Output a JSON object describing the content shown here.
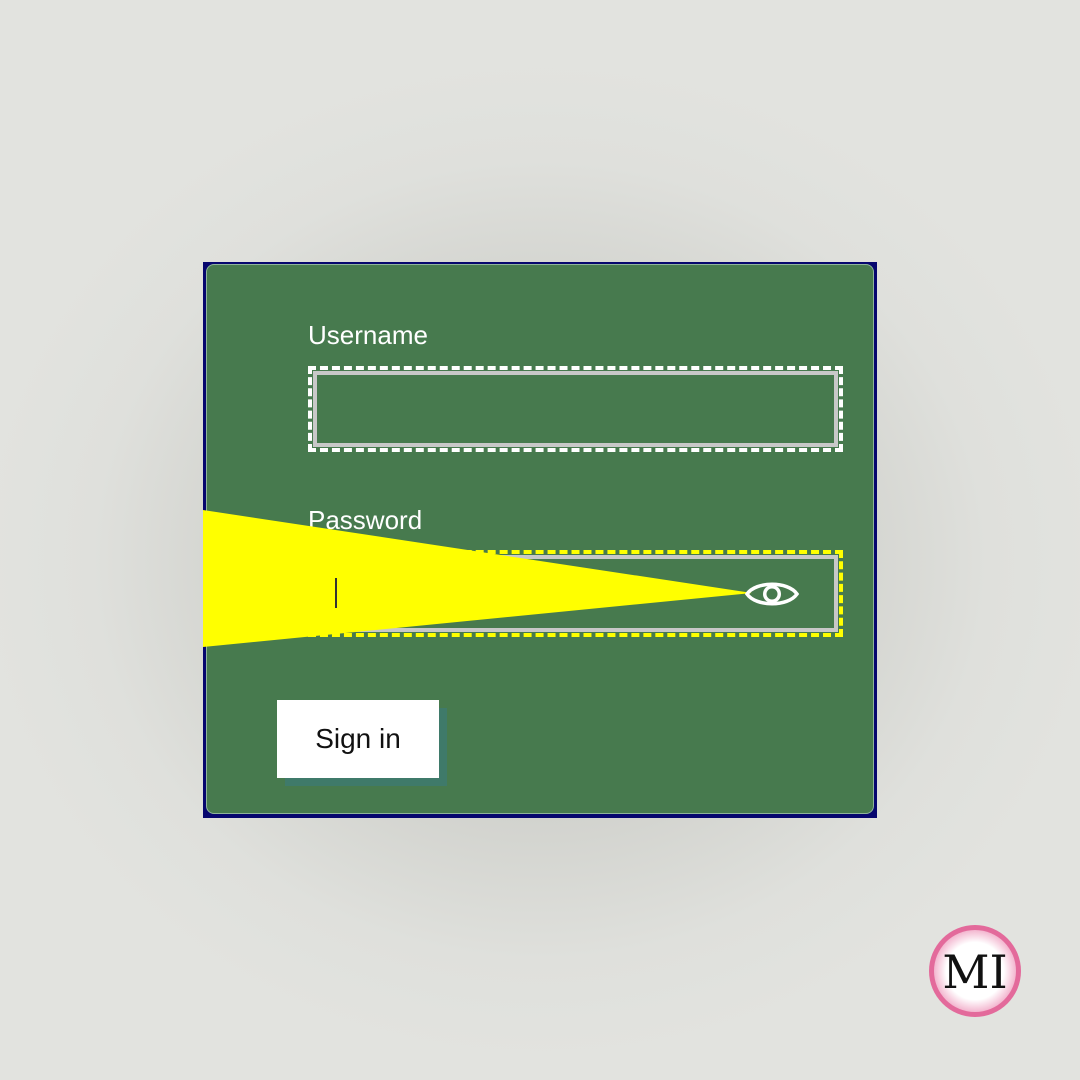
{
  "form": {
    "username_label": "Username",
    "username_value": "",
    "password_label": "Password",
    "password_value": "",
    "show_password_icon": "eye-icon",
    "signin_label": "Sign in"
  },
  "colors": {
    "page_background": "#dfe0dc",
    "card_background": "#477a4e",
    "card_frame": "#06066e",
    "focus_outline": "#ffff00",
    "field_border": "#c8c8c8",
    "button_background": "#ffffff",
    "button_shadow": "#3f7a6a",
    "beam": "#ffff00"
  },
  "logo": {
    "text": "MI",
    "ring_color": "#e36a9b"
  }
}
